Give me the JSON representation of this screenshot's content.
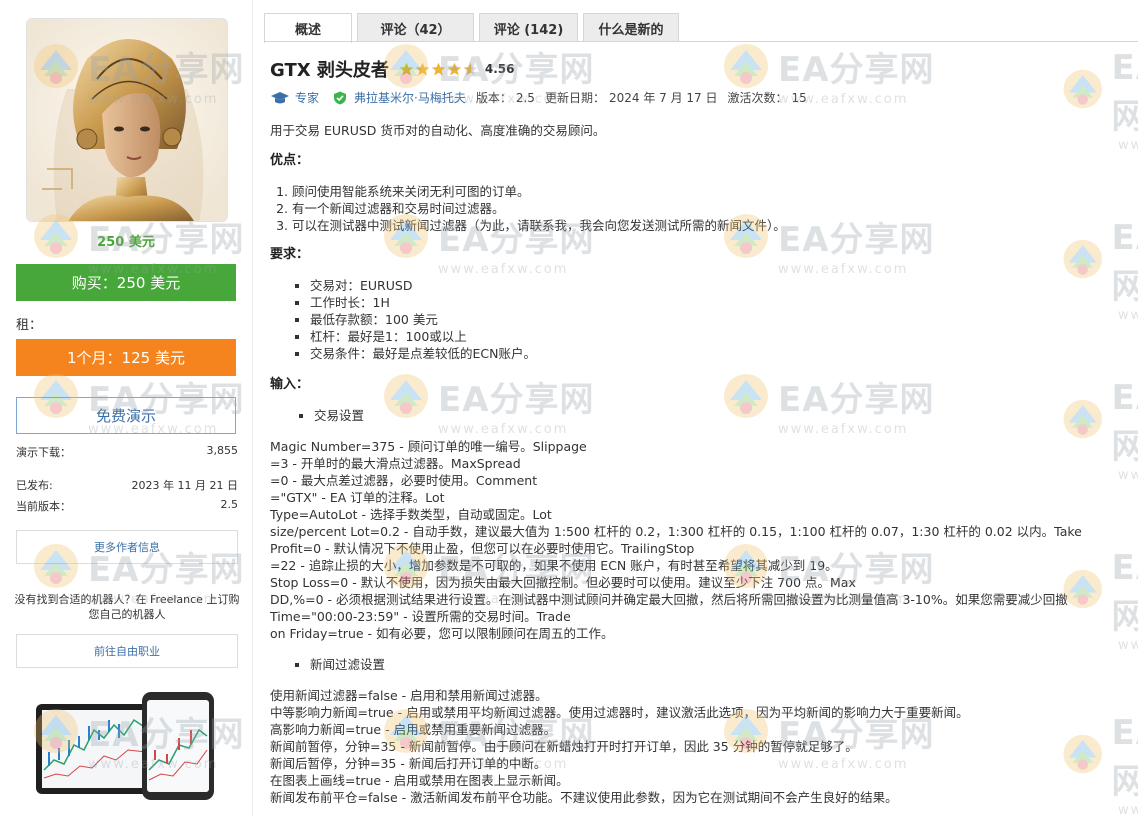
{
  "sidebar": {
    "price_small": "250 美元",
    "buy_label": "购买：250 美元",
    "rent_label": "租：",
    "rent_button": "1个月：125 美元",
    "demo_button": "免费演示",
    "demo_downloads_label": "演示下载：",
    "demo_downloads_value": "3,855",
    "published_label": "已发布:",
    "published_value": "2023 年 11 月 21 日",
    "current_version_label": "当前版本：",
    "current_version_value": "2.5",
    "more_author_info": "更多作者信息",
    "freelance_text": "没有找到合适的机器人？在 Freelance 上订购您自己的机器人",
    "freelance_button": "前往自由职业"
  },
  "tabs": [
    {
      "label": "概述"
    },
    {
      "label": "评论（42）"
    },
    {
      "label": "评论 (142)"
    },
    {
      "label": "什么是新的"
    }
  ],
  "product": {
    "title": "GTX 剥头皮者",
    "rating": "4.56",
    "author_role": "专家",
    "author_name": "弗拉基米尔·马梅托夫",
    "version_label": "版本：",
    "version_value": "2.5",
    "updated_label": "更新日期：",
    "updated_value": "2024 年 7 月 17 日",
    "activations_label": "激活次数：",
    "activations_value": "15"
  },
  "description": {
    "intro": "用于交易 EURUSD 货币对的自动化、高度准确的交易顾问。",
    "pros_heading": "优点：",
    "pros": [
      "顾问使用智能系统来关闭无利可图的订单。",
      "有一个新闻过滤器和交易时间过滤器。",
      "可以在测试器中测试新闻过滤器（为此，请联系我，我会向您发送测试所需的新闻文件）。"
    ],
    "req_heading": "要求：",
    "requirements": [
      "交易对：EURUSD",
      "工作时长：1H",
      "最低存款额：100 美元",
      "杠杆：最好是1：100或以上",
      "交易条件：最好是点差较低的ECN账户。"
    ],
    "inputs_heading": "输入：",
    "trade_settings": "交易设置",
    "trade_lines": [
      "Magic Number=375 - 顾问订单的唯一编号。Slippage",
      "=3 - 开单时的最大滑点过滤器。MaxSpread",
      "=0 - 最大点差过滤器，必要时使用。Comment",
      "=\"GTX\" - EA 订单的注释。Lot",
      "Type=AutoLot - 选择手数类型，自动或固定。Lot",
      "size/percent Lot=0.2 - 自动手数，建议最大值为 1:500 杠杆的 0.2，1:300 杠杆的 0.15，1:100 杠杆的 0.07，1:30 杠杆的 0.02 以内。Take",
      "Profit=0 - 默认情况下不使用止盈，但您可以在必要时使用它。TrailingStop",
      "=22 - 追踪止损的大小，增加参数是不可取的，如果不使用 ECN 账户，有时甚至希望将其减少到 19。",
      "Stop Loss=0 - 默认不使用，因为损失由最大回撤控制。但必要时可以使用。建议至少下注 700 点。Max",
      "DD,%=0 - 必须根据测试结果进行设置。在测试器中测试顾问并确定最大回撤，然后将所需回撤设置为比测量值高 3-10%。如果您需要减少回撤",
      "Time=\"00:00-23:59\" - 设置所需的交易时间。Trade",
      "on Friday=true - 如有必要，您可以限制顾问在周五的工作。"
    ],
    "news_settings": "新闻过滤设置",
    "news_lines": [
      "使用新闻过滤器=false - 启用和禁用新闻过滤器。",
      "中等影响力新闻=true - 启用或禁用平均新闻过滤器。使用过滤器时，建议激活此选项，因为平均新闻的影响力大于重要新闻。",
      "高影响力新闻=true - 启用或禁用重要新闻过滤器。",
      "新闻前暂停，分钟=35 - 新闻前暂停。由于顾问在新蜡烛打开时打开订单，因此 35 分钟的暂停就足够了。",
      "新闻后暂停，分钟=35 - 新闻后打开订单的中断。",
      "在图表上画线=true - 启用或禁用在图表上显示新闻。",
      "新闻发布前平仓=false - 激活新闻发布前平仓功能。不建议使用此参数，因为它在测试期间不会产生良好的结果。"
    ]
  },
  "watermark": {
    "text": "EA分享网",
    "url": "www.eafxw.com"
  },
  "colors": {
    "buy_green": "#48a73a",
    "rent_orange": "#f5841f",
    "link_blue": "#3b6fa7",
    "star_gold": "#f1b42f"
  }
}
